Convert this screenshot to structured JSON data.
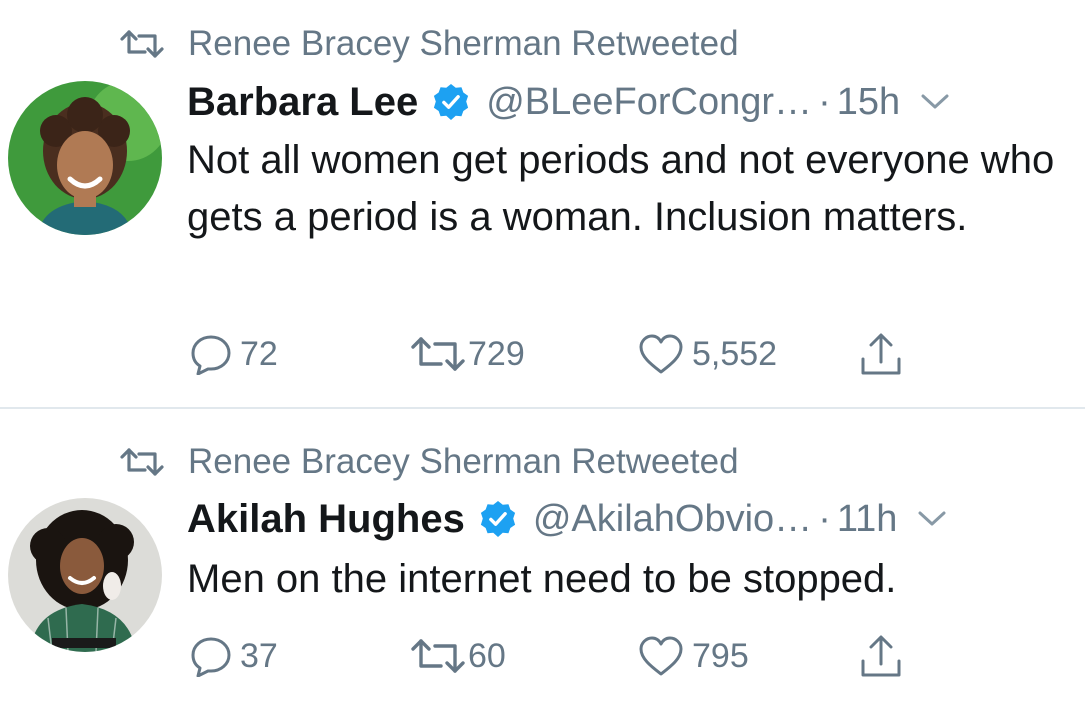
{
  "colors": {
    "secondary_text": "#657786",
    "primary_text": "#14171a",
    "verified_blue": "#1da1f2",
    "divider": "#e1e8ed"
  },
  "icons": {
    "context": "retweet-icon",
    "verified": "verified-badge-icon",
    "caret": "chevron-down-icon",
    "reply": "reply-icon",
    "retweet": "retweet-icon",
    "like": "heart-icon",
    "share": "share-icon"
  },
  "tweets": [
    {
      "context": "Renee Bracey Sherman Retweeted",
      "name": "Barbara Lee",
      "handle": "@BLeeForCongr…",
      "dot": "·",
      "time": "15h",
      "text": "Not all women get periods and not everyone who gets a period is a woman. Inclusion matters.",
      "replies": "72",
      "retweets": "729",
      "likes": "5,552"
    },
    {
      "context": "Renee Bracey Sherman Retweeted",
      "name": "Akilah Hughes",
      "handle": "@AkilahObvio…",
      "dot": "·",
      "time": "11h",
      "text": "Men on the internet need to be stopped.",
      "replies": "37",
      "retweets": "60",
      "likes": "795"
    }
  ]
}
